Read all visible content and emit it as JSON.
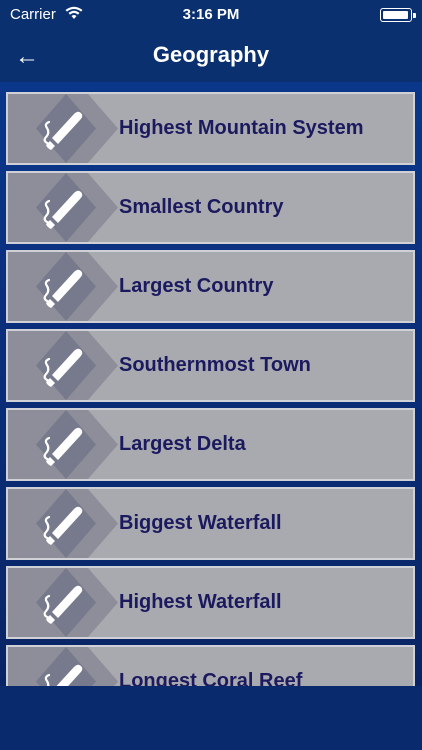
{
  "status_bar": {
    "carrier": "Carrier",
    "time": "3:16 PM",
    "battery_level": 1.0
  },
  "nav": {
    "back_icon": "←",
    "title": "Geography"
  },
  "items": [
    {
      "label": "Highest Mountain System",
      "icon": "brush-icon"
    },
    {
      "label": "Smallest Country",
      "icon": "brush-icon"
    },
    {
      "label": "Largest Country",
      "icon": "brush-icon"
    },
    {
      "label": "Southernmost Town",
      "icon": "brush-icon"
    },
    {
      "label": "Largest Delta",
      "icon": "brush-icon"
    },
    {
      "label": "Biggest Waterfall",
      "icon": "brush-icon"
    },
    {
      "label": "Highest Waterfall",
      "icon": "brush-icon"
    },
    {
      "label": "Longest Coral Reef",
      "icon": "brush-icon"
    }
  ],
  "colors": {
    "background": "#0b2f7d",
    "item_bg": "#a9aab0",
    "item_text": "#1c1a5e"
  }
}
